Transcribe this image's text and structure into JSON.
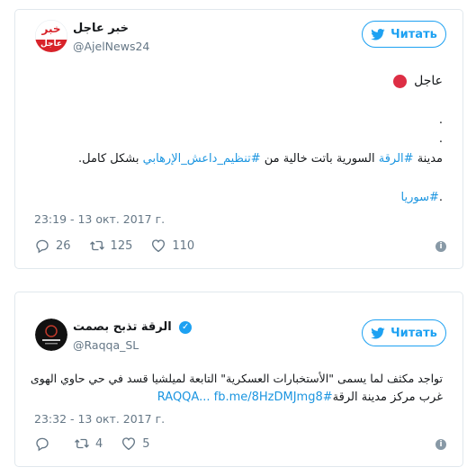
{
  "tweet1": {
    "author_name": "خبر عاجل",
    "handle": "@AjelNews24",
    "logo_top": "خبر",
    "logo_bottom": "عاجل",
    "follow_label": "Читать",
    "line1": "عاجل",
    "dot1": ".",
    "dot2": ".",
    "line3_pre": "مدينة ",
    "line3_hash1": "#الرقة",
    "line3_mid": " السورية باتت خالية من ",
    "line3_hash2": "#تنظيم_داعش_الإرهابي",
    "line3_post": " بشكل كامل.",
    "line4_hash": "#سوريا",
    "line4_dot": ".",
    "timestamp": "23:19 - 13 окт. 2017 г.",
    "replies": "26",
    "retweets": "125",
    "likes": "110",
    "info_symbol": "i"
  },
  "tweet2": {
    "author_name": "الرقة تذبح بصمت",
    "handle": "@Raqqa_SL",
    "logo_text": "RAQQA IS BEING SLAUGHTERED SILENTLY",
    "follow_label": "Читать",
    "line1": "تواجد مكثف لما يسمى \"الأستخبارات العسكرية\" التابعة لميلشيا قسد في حي حاوي الهوى",
    "line2_text": "غرب مركز مدينة الرقة",
    "line2_hash": "#RAQQA",
    "line2_sep": "... ",
    "line2_link": "fb.me/8HzDMJmg8",
    "timestamp": "23:32 - 13 окт. 2017 г.",
    "replies": "",
    "retweets": "4",
    "likes": "5",
    "info_symbol": "i"
  },
  "colors": {
    "accent": "#1da1f2",
    "link": "#1b95e0",
    "muted": "#657786",
    "dot": "#dd2e44"
  }
}
